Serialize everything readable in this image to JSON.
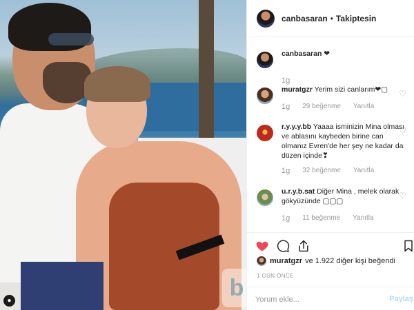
{
  "photo": {
    "watermark_text": "b"
  },
  "header": {
    "username": "canbasaran",
    "separator": "•",
    "follow_label": "Takiptesin"
  },
  "comments": [
    {
      "username": "canbasaran",
      "text": "❤",
      "time": "1g",
      "likes": "",
      "reply": ""
    },
    {
      "username": "muratgzr",
      "text": "Yerim sizi canlarım❤▢",
      "time": "1g",
      "likes": "29 beğenme",
      "reply": "Yanıtla"
    },
    {
      "username": "r.y.y.y.bb",
      "text": "Yaaaa isminizin Mina olması ve ablasını kaybeden birine can olmanız Evren'de her şey ne kadar da düzen içinde❣",
      "time": "1g",
      "likes": "32 beğenme",
      "reply": "Yanıtla"
    },
    {
      "username": "u.r.y.b.sat",
      "text": "Diğer Mina , melek olarak gökyüzünde ▢▢▢",
      "time": "1g",
      "likes": "11 beğenme",
      "reply": "Yanıtla"
    }
  ],
  "likes_summary": {
    "user": "muratgzr",
    "rest": "ve 1.922 diğer kişi beğendi"
  },
  "time_ago": "1 GÜN ÖNCE",
  "add_comment": {
    "placeholder": "Yorum ekle...",
    "share_label": "Paylaş"
  },
  "colors": {
    "heart_active": "#ed4956",
    "share_disabled": "#b3dbff"
  }
}
